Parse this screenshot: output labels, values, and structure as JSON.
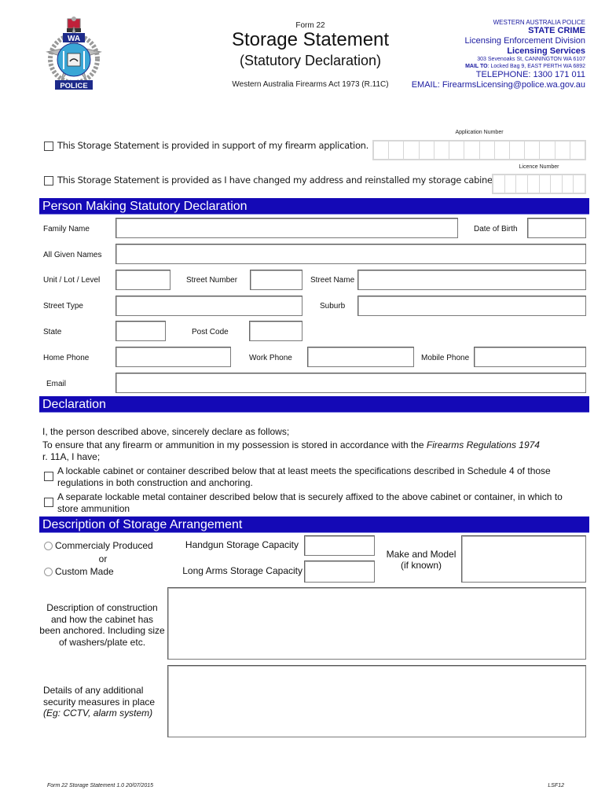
{
  "header": {
    "logo_alt": "WA Police crest",
    "logo_text_top": "WA",
    "logo_text_bottom": "POLICE",
    "form_number": "Form 22",
    "title": "Storage Statement",
    "subtitle": "(Statutory Declaration)",
    "act": "Western Australia Firearms Act 1973 (R.11C)",
    "agency": {
      "line1": "WESTERN AUSTRALIA POLICE",
      "line2": "STATE CRIME",
      "line3": "Licensing Enforcement Division",
      "line4": "Licensing Services",
      "line5": "303 Sevenoaks St, CANNINGTON  WA  6107",
      "line6_label": "MAIL TO",
      "line6_value": ": Locked Bag 9, EAST PERTH  WA  6892",
      "line7": "TELEPHONE: 1300 171 011",
      "line8": "EMAIL: FirearmsLicensing@police.wa.gov.au"
    }
  },
  "purpose": {
    "option1": "This Storage Statement is provided in support of my firearm application.",
    "option2": "This Storage Statement is provided as I have changed my address and reinstalled my storage cabinet.",
    "application_number_label": "Application Number",
    "application_number_boxes": 14,
    "licence_number_label": "Licence Number",
    "licence_number_boxes": 8
  },
  "person": {
    "section_title": "Person Making Statutory Declaration",
    "family_name": "Family Name",
    "date_of_birth": "Date of Birth",
    "given_names": "All Given Names",
    "unit": "Unit / Lot / Level",
    "street_number": "Street Number",
    "street_name": "Street Name",
    "street_type": "Street Type",
    "suburb": "Suburb",
    "state": "State",
    "post_code": "Post Code",
    "home_phone": "Home Phone",
    "work_phone": "Work Phone",
    "mobile_phone": "Mobile Phone",
    "email": "Email"
  },
  "declaration": {
    "section_title": "Declaration",
    "intro": "I, the person described above, sincerely declare as follows;",
    "ensure_prefix": "To ensure that any firearm or ammunition in my possession is stored in accordance with the ",
    "ensure_italic": "Firearms Regulations 1974",
    "ensure_suffix": "r. 11A, I have;",
    "item1": "A lockable cabinet or container described below that at least meets the specifications described in Schedule 4 of those regulations in both construction and anchoring.",
    "item2": "A separate lockable metal container described below that is securely affixed to the above cabinet or container, in which to store ammunition"
  },
  "storage": {
    "section_title": "Description of Storage Arrangement",
    "radio1": "Commercialy Produced",
    "or": "or",
    "radio2": "Custom Made",
    "handgun_capacity": "Handgun Storage Capacity",
    "long_arms_capacity": "Long Arms Storage Capacity",
    "make_model": "Make and Model",
    "make_model_note": "(if known)",
    "construction_label": "Description of construction and how the cabinet has been anchored. Including size of washers/plate etc.",
    "security_label": "Details of any additional security measures in place",
    "security_example": "(Eg: CCTV, alarm system)"
  },
  "footer": {
    "left": "Form 22 Storage Statement 1.0 20/07/2015",
    "right": "LSF12"
  },
  "colors": {
    "section_bg": "#1409b6",
    "agency_text": "#1a1aa0"
  }
}
